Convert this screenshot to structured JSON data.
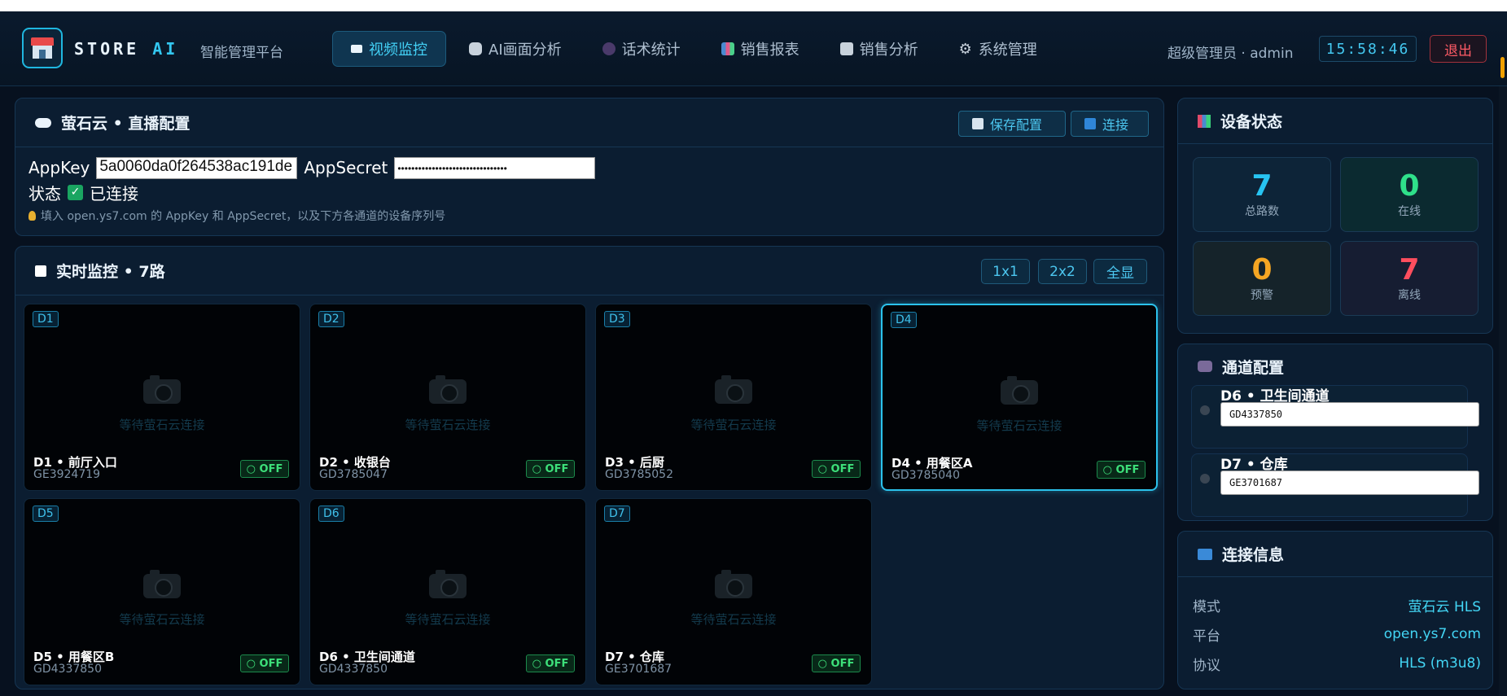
{
  "header": {
    "brand": "STORE",
    "brand_ai": "AI",
    "subtitle": "智能管理平台",
    "nav": [
      {
        "label": "视频监控",
        "icon": "camera-icon",
        "active": true
      },
      {
        "label": "AI画面分析",
        "icon": "robot-icon",
        "active": false
      },
      {
        "label": "话术统计",
        "icon": "speech-icon",
        "active": false
      },
      {
        "label": "销售报表",
        "icon": "bar-chart-icon",
        "active": false
      },
      {
        "label": "销售分析",
        "icon": "line-chart-icon",
        "active": false
      },
      {
        "label": "系统管理",
        "icon": "gear-icon",
        "active": false
      }
    ],
    "user": "超级管理员 · admin",
    "clock": "15:58:46",
    "logout": "退出"
  },
  "config_panel": {
    "title": "萤石云 • 直播配置",
    "save_label": "保存配置",
    "connect_label": "连接",
    "appkey_label": "AppKey",
    "appkey_value": "5a0060da0f264538ac191de",
    "appsecret_label": "AppSecret",
    "appsecret_value": "••••••••••••••••••••••••••••••••",
    "status_label": "状态",
    "status_value": "已连接",
    "hint": "填入 open.ys7.com 的 AppKey 和 AppSecret，以及下方各通道的设备序列号"
  },
  "monitor_panel": {
    "title": "实时监控 • 7路",
    "layout_buttons": [
      "1x1",
      "2x2",
      "全显"
    ],
    "waiting_text": "等待萤石云连接",
    "off_label": "○ OFF",
    "cameras": [
      {
        "tag": "D1",
        "name": "D1 • 前厅入口",
        "serial": "GE3924719",
        "selected": false
      },
      {
        "tag": "D2",
        "name": "D2 • 收银台",
        "serial": "GD3785047",
        "selected": false
      },
      {
        "tag": "D3",
        "name": "D3 • 后厨",
        "serial": "GD3785052",
        "selected": false
      },
      {
        "tag": "D4",
        "name": "D4 • 用餐区A",
        "serial": "GD3785040",
        "selected": true
      },
      {
        "tag": "D5",
        "name": "D5 • 用餐区B",
        "serial": "GD4337850",
        "selected": false
      },
      {
        "tag": "D6",
        "name": "D6 • 卫生间通道",
        "serial": "GD4337850",
        "selected": false
      },
      {
        "tag": "D7",
        "name": "D7 • 仓库",
        "serial": "GE3701687",
        "selected": false
      }
    ]
  },
  "device_panel": {
    "title": "设备状态",
    "stats": [
      {
        "value": "7",
        "label": "总路数",
        "color": "#27c4f2"
      },
      {
        "value": "0",
        "label": "在线",
        "color": "#2fe08a"
      },
      {
        "value": "0",
        "label": "预警",
        "color": "#f5a623"
      },
      {
        "value": "7",
        "label": "离线",
        "color": "#ff4e5e"
      }
    ]
  },
  "channel_panel": {
    "title": "通道配置",
    "channels": [
      {
        "name": "D6 • 卫生间通道",
        "serial": "GD4337850"
      },
      {
        "name": "D7 • 仓库",
        "serial": "GE3701687"
      }
    ]
  },
  "connection_panel": {
    "title": "连接信息",
    "rows": [
      {
        "key": "模式",
        "value": "萤石云 HLS"
      },
      {
        "key": "平台",
        "value": "open.ys7.com"
      },
      {
        "key": "协议",
        "value": "HLS (m3u8)"
      }
    ]
  },
  "colors": {
    "accent": "#27c4f2",
    "background": "#07111f",
    "panel": "#0b1d31",
    "online": "#2fe08a",
    "danger": "#ff4e5e",
    "warning": "#f5a623"
  }
}
